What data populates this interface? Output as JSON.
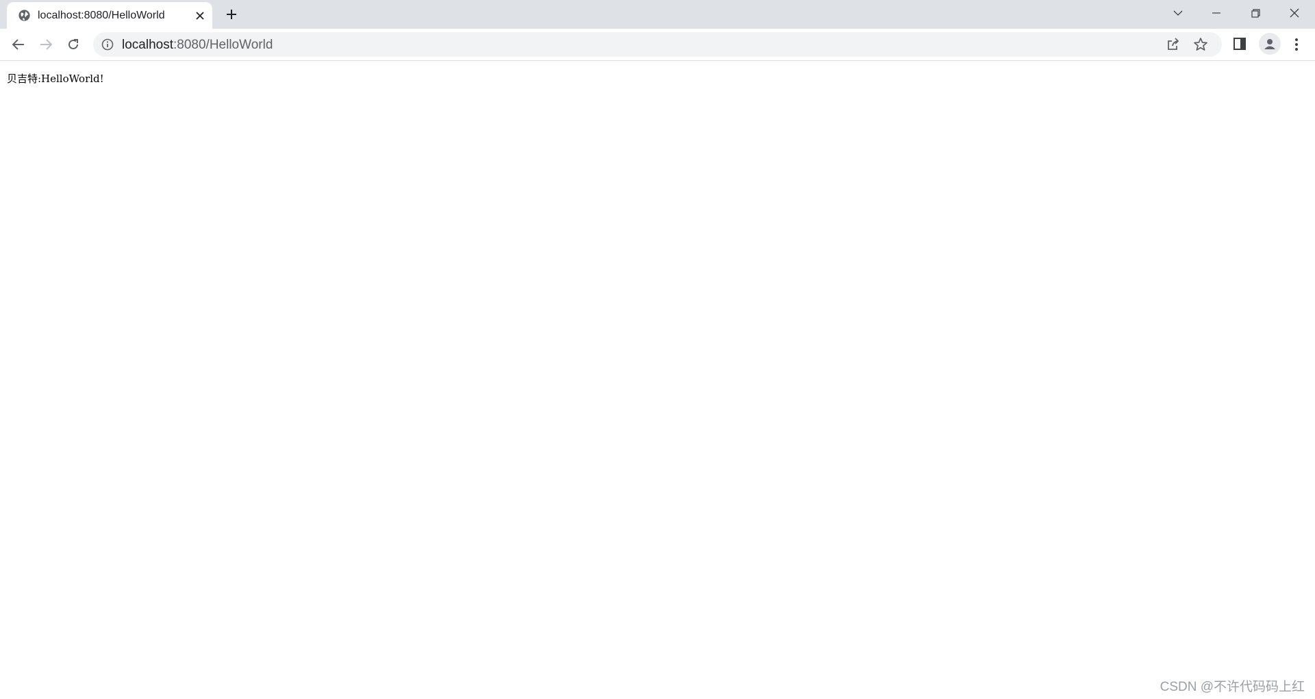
{
  "tab": {
    "title": "localhost:8080/HelloWorld",
    "favicon": "globe-icon"
  },
  "toolbar": {
    "url_host": "localhost",
    "url_rest": ":8080/HelloWorld"
  },
  "page": {
    "text": "贝吉特:HelloWorld!"
  },
  "watermark": "CSDN @不许代码码上红",
  "colors": {
    "tabstrip": "#dee1e6",
    "omnibox": "#f1f3f4",
    "icon": "#5f6368"
  }
}
